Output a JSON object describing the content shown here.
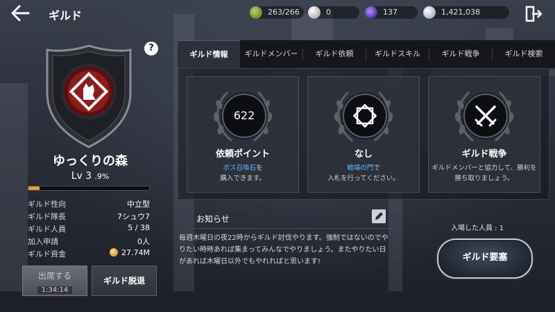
{
  "header": {
    "title": "ギルド",
    "resources": [
      {
        "icon": "guild-energy-icon",
        "value": "263/266",
        "color": "#7a9a3a"
      },
      {
        "icon": "pearl-icon",
        "value": "0",
        "color": "#d9d2c9"
      },
      {
        "icon": "dark-orb-icon",
        "value": "137",
        "color": "#6b3bd6"
      },
      {
        "icon": "silver-coin-icon",
        "value": "1,421,038",
        "color": "#c8d8e8"
      }
    ]
  },
  "guild": {
    "name": "ゆっくりの森",
    "level_label": "Lv 3",
    "level_percent_label": ".9%",
    "xp_progress": 0.09,
    "info": [
      {
        "key": "ギルド性向",
        "value": "中立型"
      },
      {
        "key": "ギルド隊長",
        "value": "7シュウ7"
      },
      {
        "key": "ギルド人員",
        "value": "5 / 38"
      },
      {
        "key": "加入申請",
        "value": "0人"
      },
      {
        "key": "ギルド資金",
        "value": "27.74M"
      }
    ]
  },
  "buttons": {
    "attend_label": "出席する",
    "attend_timer": "1:34:14",
    "leave_label": "ギルド脱退",
    "fortress_label": "ギルド要塞",
    "help_label": "?"
  },
  "tabs": [
    {
      "label": "ギルド情報",
      "active": true
    },
    {
      "label": "ギルドメンバー",
      "active": false
    },
    {
      "label": "ギルド依頼",
      "active": false
    },
    {
      "label": "ギルドスキル",
      "active": false
    },
    {
      "label": "ギルド戦争",
      "active": false
    },
    {
      "label": "ギルド検索",
      "active": false
    }
  ],
  "cards": [
    {
      "badge": "622",
      "title": "依頼ポイント",
      "desc_hl": "ボス召喚石",
      "desc_1": "を",
      "desc_2": "購入できます。"
    },
    {
      "icon": "battlefield-gate-icon",
      "title": "なし",
      "desc_hl": "戦場の門",
      "desc_1": "で",
      "desc_2": "入札を行ってください。"
    },
    {
      "icon": "crossed-swords-icon",
      "title": "ギルド戦争",
      "desc_hl": "",
      "desc_1": "ギルドメンバーと協力して、勝利を",
      "desc_2": "勝ち取りましょう。"
    }
  ],
  "notice": {
    "title": "お知らせ",
    "body": "毎週木曜日の夜22時からギルド討伐やります。強制ではないのでやりたい時時あれば集まってみんなでやりましょう。またやりたい日があれば木曜日以外でもやれればと思います!"
  },
  "fortress": {
    "joined_label": "入場した人員 : 1"
  }
}
